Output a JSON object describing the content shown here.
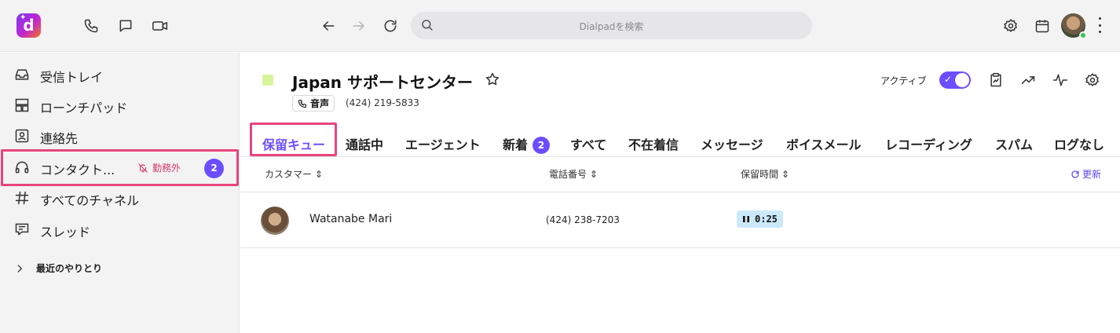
{
  "topbar": {
    "logo_letter": "d",
    "search_placeholder": "Dialpadを検索"
  },
  "sidebar": {
    "items": [
      {
        "label": "受信トレイ"
      },
      {
        "label": "ローンチパッド"
      },
      {
        "label": "連絡先"
      },
      {
        "label": "コンタクト..."
      },
      {
        "label": "すべてのチャネル"
      },
      {
        "label": "スレッド"
      }
    ],
    "contact_status": "勤務外",
    "contact_badge": "2",
    "recent_label": "最近のやりとり"
  },
  "channel": {
    "title": "Japan サポートセンター",
    "type_label": "音声",
    "phone": "(424) 219-5833",
    "active_label": "アクティブ",
    "active": true,
    "color": "#d6f59b"
  },
  "tabs": [
    {
      "label": "保留キュー",
      "active": true
    },
    {
      "label": "通話中"
    },
    {
      "label": "エージェント"
    },
    {
      "label": "新着",
      "badge": "2"
    },
    {
      "label": "すべて"
    },
    {
      "label": "不在着信"
    },
    {
      "label": "メッセージ"
    },
    {
      "label": "ボイスメール"
    },
    {
      "label": "レコーディング"
    },
    {
      "label": "スパム"
    },
    {
      "label": "ログなし"
    }
  ],
  "table": {
    "columns": [
      "カスタマー",
      "電話番号",
      "保留時間"
    ],
    "refresh_label": "更新",
    "rows": [
      {
        "name": "Watanabe Mari",
        "phone": "(424) 238-7203",
        "hold_time": "0:25"
      }
    ]
  },
  "colors": {
    "accent": "#6b4eff",
    "highlight": "#e8457d",
    "hold_chip": "#cbe9fb"
  }
}
